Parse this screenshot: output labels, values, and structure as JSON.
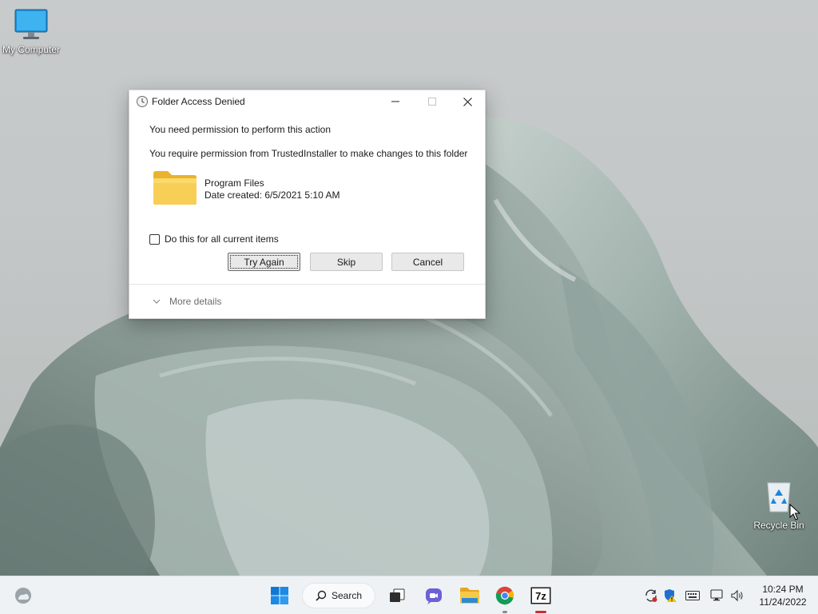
{
  "desktop": {
    "icons": [
      {
        "label": "My Computer",
        "icon": "monitor-icon"
      },
      {
        "label": "Recycle Bin",
        "icon": "recycle-bin-icon"
      }
    ]
  },
  "dialog": {
    "title": "Folder Access Denied",
    "message": "You need permission to perform this action",
    "detail": "You require permission from TrustedInstaller to make changes to this folder",
    "item": {
      "name": "Program Files",
      "date": "Date created: 6/5/2021 5:10 AM",
      "icon": "folder-icon"
    },
    "checkbox": {
      "label": "Do this for all current items",
      "checked": false
    },
    "buttons": {
      "try_again": "Try Again",
      "skip": "Skip",
      "cancel": "Cancel"
    },
    "more_details": "More details"
  },
  "taskbar": {
    "search_label": "Search",
    "apps": [
      "start-icon",
      "search-icon",
      "task-view-icon",
      "chat-icon",
      "file-explorer-icon",
      "chrome-icon",
      "7zip-icon"
    ],
    "tray": [
      "sync-icon",
      "security-shield-icon",
      "keyboard-icon",
      "network-icon",
      "volume-icon"
    ],
    "clock_time": "10:24 PM",
    "clock_date": "11/24/2022"
  },
  "colors": {
    "accent": "#0067c0",
    "folder": "#f5c842",
    "wallpaper": "#9fb0aa",
    "sevenzip_indicator": "#d12c2c"
  }
}
